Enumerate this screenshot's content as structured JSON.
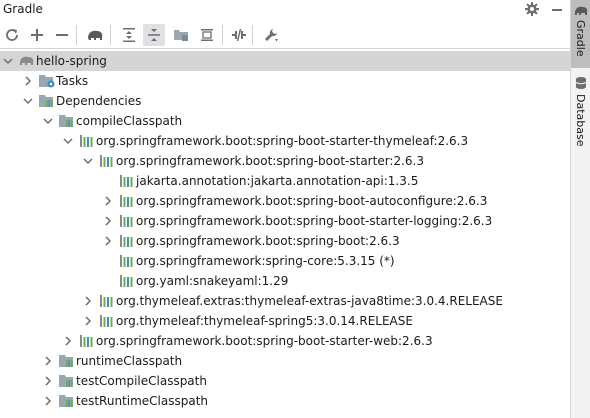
{
  "header": {
    "title": "Gradle",
    "gear_icon": "gear-icon",
    "minimize_icon": "minimize-icon"
  },
  "toolbar": {
    "buttons": [
      {
        "name": "reload-all-gradle-projects-button",
        "icon": "refresh-icon"
      },
      {
        "name": "add-gradle-project-button",
        "icon": "plus-icon"
      },
      {
        "name": "unlink-gradle-project-button",
        "icon": "minus-icon"
      },
      {
        "name": "execute-gradle-task-button",
        "icon": "elephant-icon"
      },
      {
        "name": "expand-all-button",
        "icon": "expand-all-icon"
      },
      {
        "name": "collapse-all-button",
        "icon": "collapse-all-icon"
      },
      {
        "name": "group-modules-button",
        "icon": "folder-group-icon"
      },
      {
        "name": "show-dependencies-button",
        "icon": "dependencies-icon"
      },
      {
        "name": "toggle-offline-mode-button",
        "icon": "offline-icon"
      },
      {
        "name": "build-tool-settings-button",
        "icon": "wrench-icon"
      }
    ]
  },
  "tree": [
    {
      "label": "hello-spring",
      "level": 0,
      "expanded": true,
      "icon": "gradle-project-icon",
      "selected": true
    },
    {
      "label": "Tasks",
      "level": 1,
      "expanded": false,
      "icon": "tasks-folder-icon"
    },
    {
      "label": "Dependencies",
      "level": 1,
      "expanded": true,
      "icon": "dependencies-folder-icon"
    },
    {
      "label": "compileClasspath",
      "level": 2,
      "expanded": true,
      "icon": "configuration-icon"
    },
    {
      "label": "org.springframework.boot:spring-boot-starter-thymeleaf:2.6.3",
      "level": 3,
      "expanded": true,
      "icon": "library-icon"
    },
    {
      "label": "org.springframework.boot:spring-boot-starter:2.6.3",
      "level": 4,
      "expanded": true,
      "icon": "library-icon"
    },
    {
      "label": "jakarta.annotation:jakarta.annotation-api:1.3.5",
      "level": 5,
      "leaf": true,
      "icon": "library-icon"
    },
    {
      "label": "org.springframework.boot:spring-boot-autoconfigure:2.6.3",
      "level": 5,
      "expanded": false,
      "icon": "library-icon"
    },
    {
      "label": "org.springframework.boot:spring-boot-starter-logging:2.6.3",
      "level": 5,
      "expanded": false,
      "icon": "library-icon"
    },
    {
      "label": "org.springframework.boot:spring-boot:2.6.3",
      "level": 5,
      "expanded": false,
      "icon": "library-icon"
    },
    {
      "label": "org.springframework:spring-core:5.3.15 (*)",
      "level": 5,
      "leaf": true,
      "icon": "library-icon"
    },
    {
      "label": "org.yaml:snakeyaml:1.29",
      "level": 5,
      "leaf": true,
      "icon": "library-icon"
    },
    {
      "label": "org.thymeleaf.extras:thymeleaf-extras-java8time:3.0.4.RELEASE",
      "level": 4,
      "expanded": false,
      "icon": "library-icon"
    },
    {
      "label": "org.thymeleaf:thymeleaf-spring5:3.0.14.RELEASE",
      "level": 4,
      "expanded": false,
      "icon": "library-icon"
    },
    {
      "label": "org.springframework.boot:spring-boot-starter-web:2.6.3",
      "level": 3,
      "expanded": false,
      "icon": "library-icon"
    },
    {
      "label": "runtimeClasspath",
      "level": 2,
      "expanded": false,
      "icon": "configuration-icon"
    },
    {
      "label": "testCompileClasspath",
      "level": 2,
      "expanded": false,
      "icon": "configuration-icon"
    },
    {
      "label": "testRuntimeClasspath",
      "level": 2,
      "expanded": false,
      "icon": "configuration-icon"
    }
  ],
  "right_sidebar": {
    "tabs": [
      {
        "label": "Gradle",
        "active": true,
        "icon": "gradle-elephant-icon"
      },
      {
        "label": "Database",
        "active": false,
        "icon": "database-icon"
      }
    ]
  },
  "colors": {
    "selection": "#d5d5d5",
    "icon_gray": "#6e6e6e",
    "library_green": "#62b543",
    "library_blue": "#4a86c8",
    "folder_gray": "#9aa7b0"
  }
}
